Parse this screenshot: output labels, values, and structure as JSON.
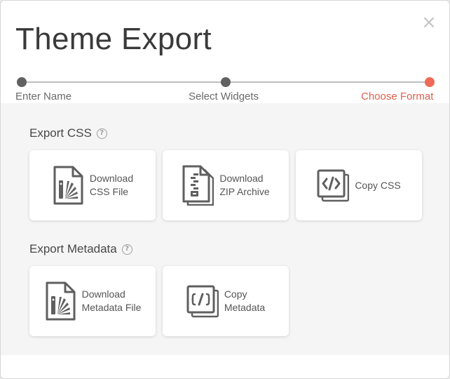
{
  "dialog": {
    "title": "Theme Export",
    "close_glyph": "×"
  },
  "stepper": {
    "steps": [
      {
        "label": "Enter Name",
        "state": "done"
      },
      {
        "label": "Select Widgets",
        "state": "done"
      },
      {
        "label": "Choose Format",
        "state": "active"
      }
    ]
  },
  "sections": {
    "css": {
      "title": "Export CSS",
      "help_glyph": "?",
      "cards": [
        {
          "line1": "Download",
          "line2": "CSS File",
          "icon": "file-css-icon"
        },
        {
          "line1": "Download",
          "line2": "ZIP Archive",
          "icon": "zip-archive-icon"
        },
        {
          "line1": "Copy CSS",
          "line2": "",
          "icon": "code-copy-icon"
        }
      ]
    },
    "metadata": {
      "title": "Export Metadata",
      "help_glyph": "?",
      "cards": [
        {
          "line1": "Download",
          "line2": "Metadata File",
          "icon": "file-metadata-icon"
        },
        {
          "line1": "Copy",
          "line2": "Metadata",
          "icon": "json-copy-icon"
        }
      ]
    }
  },
  "colors": {
    "accent": "#ee6a57",
    "step_done": "#616161",
    "icon": "#5f5f5f"
  }
}
